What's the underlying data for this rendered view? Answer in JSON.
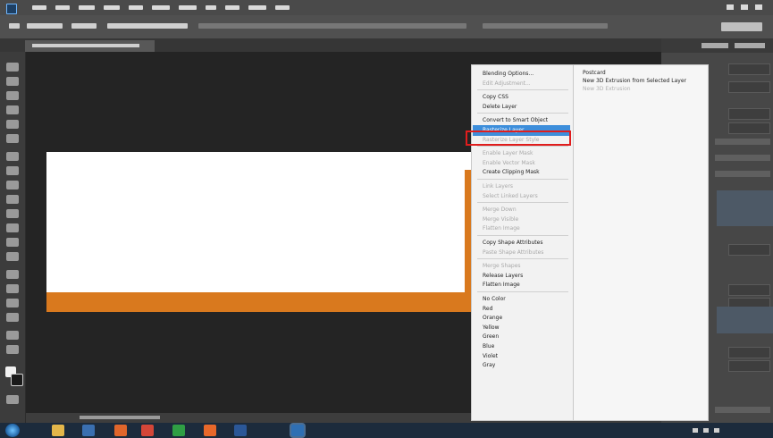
{
  "app": {
    "menu_items": [
      "File",
      "Edit",
      "Image",
      "Layer",
      "Type",
      "Select",
      "Filter",
      "3D",
      "View",
      "Window",
      "Help"
    ]
  },
  "document": {
    "white_color": "#ffffff",
    "orange_color": "#d9791e"
  },
  "context_menu": {
    "items": [
      {
        "label": "Blending Options...",
        "disabled": false
      },
      {
        "label": "Edit Adjustment...",
        "disabled": true
      },
      {
        "label": "",
        "sep": true
      },
      {
        "label": "Copy CSS",
        "disabled": false
      },
      {
        "label": "Delete Layer",
        "disabled": false
      },
      {
        "label": "",
        "sep": true
      },
      {
        "label": "Convert to Smart Object",
        "disabled": false
      },
      {
        "label": "Rasterize Layer",
        "disabled": false,
        "highlighted": true
      },
      {
        "label": "Rasterize Layer Style",
        "disabled": true
      },
      {
        "label": "",
        "sep": true
      },
      {
        "label": "Enable Layer Mask",
        "disabled": true
      },
      {
        "label": "Enable Vector Mask",
        "disabled": true
      },
      {
        "label": "Create Clipping Mask",
        "disabled": false
      },
      {
        "label": "",
        "sep": true
      },
      {
        "label": "Link Layers",
        "disabled": true
      },
      {
        "label": "Select Linked Layers",
        "disabled": true
      },
      {
        "label": "",
        "sep": true
      },
      {
        "label": "Merge Down",
        "disabled": true
      },
      {
        "label": "Merge Visible",
        "disabled": true
      },
      {
        "label": "Flatten Image",
        "disabled": true
      },
      {
        "label": "",
        "sep": true
      },
      {
        "label": "Copy Shape Attributes",
        "disabled": false
      },
      {
        "label": "Paste Shape Attributes",
        "disabled": true
      },
      {
        "label": "",
        "sep": true
      },
      {
        "label": "Merge Shapes",
        "disabled": true
      },
      {
        "label": "Release Layers",
        "disabled": false
      },
      {
        "label": "Flatten Image",
        "disabled": false
      },
      {
        "label": "",
        "sep": true
      },
      {
        "label": "No Color",
        "disabled": false
      },
      {
        "label": "Red",
        "disabled": false
      },
      {
        "label": "Orange",
        "disabled": false
      },
      {
        "label": "Yellow",
        "disabled": false
      },
      {
        "label": "Green",
        "disabled": false
      },
      {
        "label": "Blue",
        "disabled": false
      },
      {
        "label": "Violet",
        "disabled": false
      },
      {
        "label": "Gray",
        "disabled": false
      }
    ]
  },
  "sub_menu": {
    "items": [
      {
        "label": "Postcard",
        "disabled": false
      },
      {
        "label": "New 3D Extrusion from Selected Layer",
        "disabled": false
      },
      {
        "label": "New 3D Extrusion",
        "disabled": true
      }
    ]
  },
  "taskbar": {
    "icons": [
      {
        "name": "explorer-icon",
        "color": "#e3b64a"
      },
      {
        "name": "media-icon",
        "color": "#3a6fb0"
      },
      {
        "name": "firefox-icon",
        "color": "#e0662b"
      },
      {
        "name": "gmail-icon",
        "color": "#d44638"
      },
      {
        "name": "chrome-icon",
        "color": "#2f9e44"
      },
      {
        "name": "files-icon",
        "color": "#e8682a"
      },
      {
        "name": "word-icon",
        "color": "#2b5797"
      },
      {
        "name": "photoshop-icon",
        "color": "#2f6fb3"
      }
    ]
  },
  "colors": {
    "highlight": "#3d8edb",
    "annotation": "#e01d1d"
  }
}
